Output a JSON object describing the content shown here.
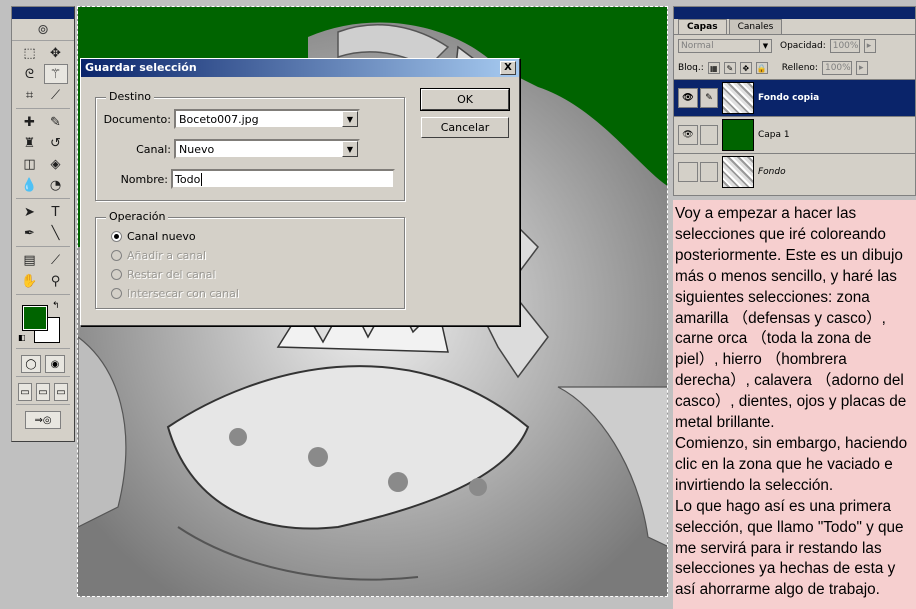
{
  "dialog": {
    "title": "Guardar selección",
    "close_label": "X",
    "destino": {
      "legend": "Destino",
      "documento_label": "Documento:",
      "documento_value": "Boceto007.jpg",
      "canal_label": "Canal:",
      "canal_value": "Nuevo",
      "nombre_label": "Nombre:",
      "nombre_value": "Todo"
    },
    "operacion": {
      "legend": "Operación",
      "options": [
        "Canal nuevo",
        "Añadir a canal",
        "Restar del canal",
        "Intersecar con canal"
      ]
    },
    "ok_label": "OK",
    "cancel_label": "Cancelar"
  },
  "layers_panel": {
    "tabs": [
      "Capas",
      "Canales"
    ],
    "blend_mode": "Normal",
    "opacity_label": "Opacidad:",
    "opacity_value": "100%",
    "lock_label": "Bloq.:",
    "fill_label": "Relleno:",
    "fill_value": "100%",
    "layers": [
      {
        "name": "Fondo copia",
        "selected": true
      },
      {
        "name": "Capa 1",
        "selected": false
      },
      {
        "name": "Fondo",
        "selected": false
      }
    ]
  },
  "note": {
    "paragraphs": [
      "Voy a empezar a hacer las selecciones que iré coloreando posteriormente. Este es un dibujo más o menos sencillo, y haré las siguientes selecciones: zona amarilla （defensas y casco）, carne orca （toda la zona de piel）, hierro （hombrera derecha）, calavera （adorno del casco）, dientes, ojos y placas de metal brillante.",
      "Comienzo, sin embargo, haciendo clic en la zona que he vaciado e invirtiendo la selección.",
      "Lo que hago así es una primera selección, que llamo \"Todo\" y que me servirá para ir restando las selecciones ya hechas de esta y así ahorrarme algo de trabajo."
    ]
  },
  "colors": {
    "foreground": "#006400",
    "background": "#ffffff",
    "titlebar": "#0a246a",
    "note_bg": "#f6cfcf"
  }
}
